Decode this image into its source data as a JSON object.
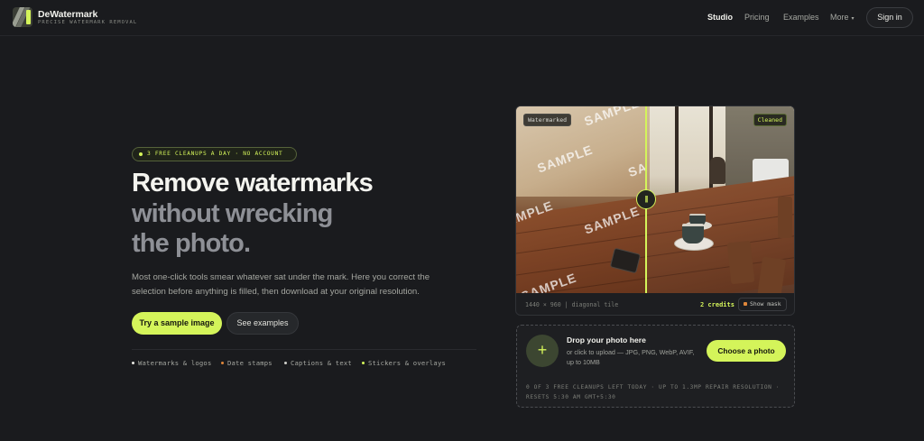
{
  "header": {
    "brand_name": "DeWatermark",
    "brand_tagline": "PRECISE WATERMARK REMOVAL",
    "nav": [
      {
        "label": "Studio",
        "active": true
      },
      {
        "label": "Pricing",
        "active": false
      },
      {
        "label": "Examples",
        "active": false
      },
      {
        "label": "More",
        "active": false
      }
    ],
    "signin_label": "Sign in"
  },
  "hero": {
    "badge": "3 FREE CLEANUPS A DAY · NO ACCOUNT",
    "headline_line1": "Remove watermarks",
    "headline_line2": "without wrecking",
    "headline_line3": "the photo.",
    "lead": "Most one-click tools smear whatever sat under the mark. Here you correct the selection before anything is filled, then download at your original resolution.",
    "primary_cta": "Try a sample image",
    "secondary_cta": "See examples",
    "features": [
      {
        "label": "Watermarks & logos",
        "color": "#e8e8e2"
      },
      {
        "label": "Date stamps",
        "color": "#e0873a"
      },
      {
        "label": "Captions & text",
        "color": "#cfd0cb"
      },
      {
        "label": "Stickers & overlays",
        "color": "#d4f45a"
      }
    ]
  },
  "preview": {
    "tag_left": "Watermarked",
    "tag_right": "Cleaned",
    "watermark_text": "SAMPLE",
    "watermark_fragment": "SA",
    "split_knob": "|||",
    "dims": "1440 × 960 | diagonal tile",
    "credits": "2 credits",
    "show_mask": "Show mask"
  },
  "dropzone": {
    "plus": "+",
    "title": "Drop your photo here",
    "subtitle": "or click to upload — JPG, PNG, WebP, AVIF, up to 10MB",
    "button": "Choose a photo",
    "quota": "0 OF 3 FREE CLEANUPS LEFT TODAY · UP TO 1.3MP REPAIR RESOLUTION · RESETS 5:30 AM GMT+5:30"
  },
  "colors": {
    "accent": "#d4f45a",
    "background": "#1a1b1e"
  }
}
